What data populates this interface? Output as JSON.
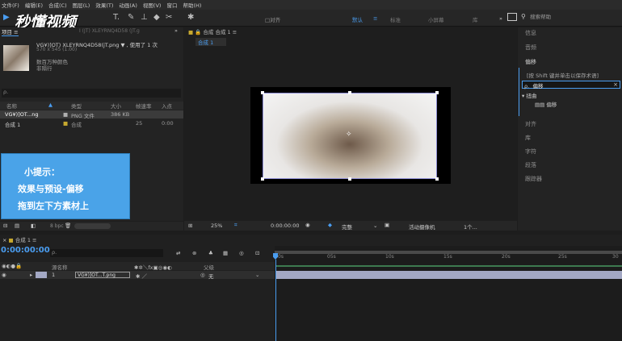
{
  "menubar": [
    "文件(F)",
    "编辑(E)",
    "合成(C)",
    "图层(L)",
    "效果(T)",
    "动画(A)",
    "视图(V)",
    "窗口",
    "帮助(H)"
  ],
  "toolbar": {
    "align_label": "□对齐",
    "workspaces": [
      "默认",
      "≡",
      "标准",
      "小屏幕",
      "库"
    ],
    "search_placeholder": "搜索帮助",
    "watermark": "秒懂视频"
  },
  "project_panel": {
    "tab_label": "项目 ≡",
    "breadcrumb": "I (JT) XLEYRNQ4D58 (JT.g",
    "file_name": "VG¥)]OT) XLEYRNQ4D58(jT.png ▼ , 使用了 1 次",
    "file_dims": "570 x 545 (1.00)",
    "color_info": "数百万种颜色",
    "interlace": "非隔行",
    "search_placeholder": "ρ.",
    "columns": [
      "名称",
      "类型",
      "大小",
      "帧速率",
      "入点"
    ],
    "items": [
      {
        "name": "VG¥)]OT...ng",
        "type": "PNG 文件",
        "size": "386 KB",
        "fps": "",
        "in": ""
      },
      {
        "name": "合成 1",
        "type": "合成",
        "size": "",
        "fps": "25",
        "in": "0:00"
      }
    ],
    "bpc": "8 bpc"
  },
  "tip": {
    "title": "小提示：",
    "line1": "效果与预设-偏移",
    "line2": "拖到左下方素材上"
  },
  "composition": {
    "tab_label": "合成 合成 1 ≡",
    "sub_tab": "合成 1",
    "zoom": "25%",
    "timecode": "0:00:00:00",
    "quality": "完整",
    "camera": "活动摄像机",
    "views": "1个..."
  },
  "right_panel": {
    "items_top": [
      "信息",
      "音频"
    ],
    "effects_title": "偏移",
    "hint": "[按 Shift 键并单击以保存术语]",
    "search_value": "偏移",
    "category": "扭曲",
    "effect_item": "偏移",
    "items_bottom": [
      "对齐",
      "库",
      "字符",
      "段落",
      "跟踪器"
    ]
  },
  "timeline": {
    "tab_label": "合成 1 ≡",
    "timecode": "0:00:00:00",
    "search_placeholder": "ρ.",
    "col_name": "源名称",
    "col_parent": "父级",
    "layer_number": "1",
    "layer_name": "VG¥)]OT...T.png",
    "parent_value": "无",
    "ruler": [
      "0s",
      "05s",
      "10s",
      "15s",
      "20s",
      "25s",
      "30"
    ]
  },
  "colors": {
    "accent_blue": "#4aa3e8",
    "timecode_blue": "#4a9df0",
    "layer_bar": "#a3a8c4"
  }
}
